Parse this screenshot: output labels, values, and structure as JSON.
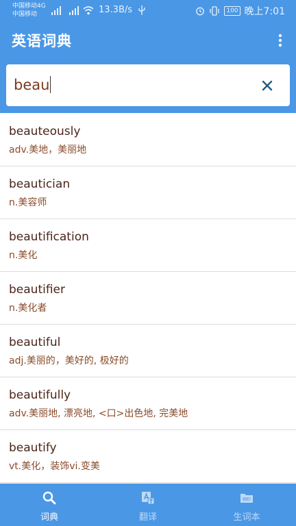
{
  "status_bar": {
    "carrier_line1": "中国移动4G",
    "carrier_line2": "中国移动",
    "speed": "13.3B/s",
    "battery": "100",
    "time": "晚上7:01"
  },
  "app": {
    "title": "英语词典"
  },
  "search": {
    "value": "beau"
  },
  "words": [
    {
      "en": "beauteously",
      "zh": "adv.美地，美丽地"
    },
    {
      "en": "beautician",
      "zh": "n.美容师"
    },
    {
      "en": "beautification",
      "zh": "n.美化"
    },
    {
      "en": "beautifier",
      "zh": "n.美化者"
    },
    {
      "en": "beautiful",
      "zh": "adj.美丽的，美好的, 极好的"
    },
    {
      "en": "beautifully",
      "zh": "adv.美丽地, 漂亮地, <口>出色地, 完美地"
    },
    {
      "en": "beautify",
      "zh": "vt.美化，装饰vi.变美"
    }
  ],
  "bottom_nav": {
    "dictionary": "词典",
    "translate": "翻译",
    "vocabulary": "生词本"
  },
  "colors": {
    "primary": "#4a97e6",
    "word_text": "#4b2418",
    "definition_text": "#8a4a2a"
  }
}
